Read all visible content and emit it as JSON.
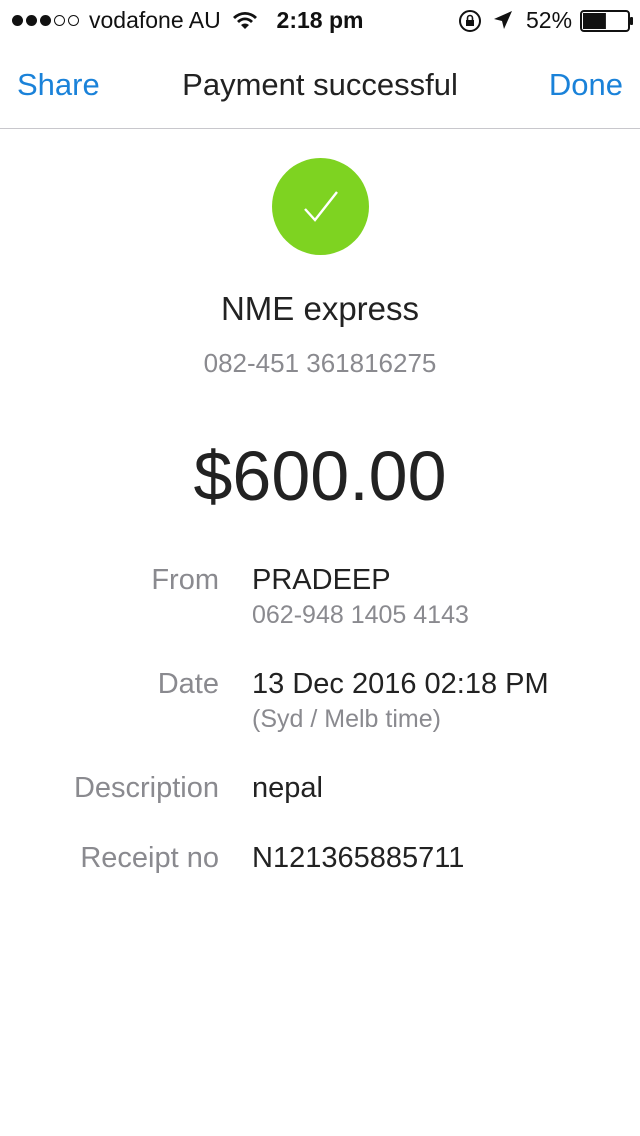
{
  "status_bar": {
    "carrier": "vodafone AU",
    "time": "2:18 pm",
    "battery_percent": "52%",
    "battery_level": 0.52,
    "signal_bars": 3,
    "signal_total": 5
  },
  "nav": {
    "share_label": "Share",
    "title": "Payment successful",
    "done_label": "Done"
  },
  "payee": {
    "name": "NME express",
    "account": "082-451 361816275"
  },
  "amount": "$600.00",
  "details": {
    "from_label": "From",
    "from_name": "PRADEEP",
    "from_account": "062-948 1405 4143",
    "date_label": "Date",
    "date_value": "13 Dec 2016 02:18 PM",
    "date_note": "(Syd / Melb time)",
    "description_label": "Description",
    "description_value": "nepal",
    "receipt_label": "Receipt no",
    "receipt_value": "N121365885711"
  },
  "colors": {
    "accent": "#1a82d9",
    "success": "#7ed321",
    "secondary_text": "#8a8a8f"
  },
  "icons": [
    "signal-dots-icon",
    "wifi-icon",
    "rotation-lock-icon",
    "location-arrow-icon",
    "battery-icon",
    "checkmark-icon"
  ]
}
